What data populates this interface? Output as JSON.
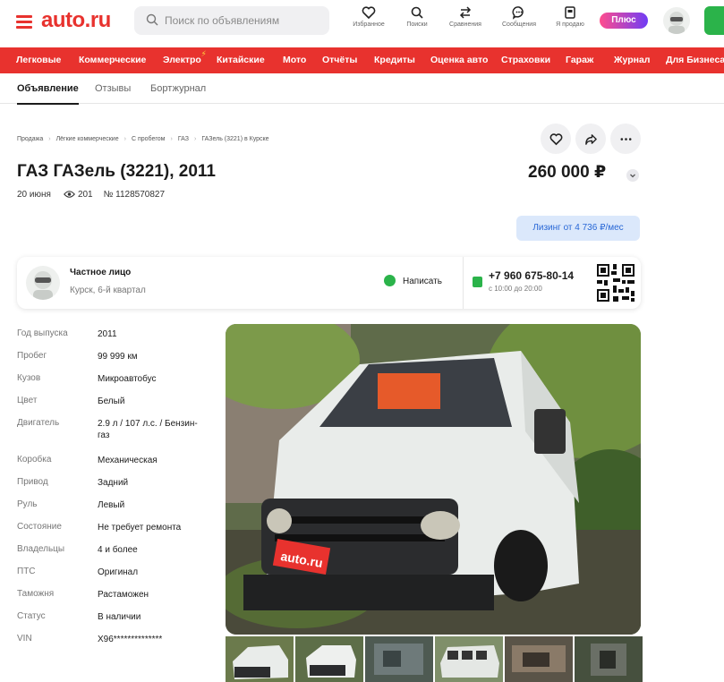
{
  "header": {
    "logo": "auto.ru",
    "search_placeholder": "Поиск по объявлениям",
    "items": [
      {
        "label": "Избранное",
        "icon": "heart-icon"
      },
      {
        "label": "Поиски",
        "icon": "saved-search-icon"
      },
      {
        "label": "Сравнения",
        "icon": "compare-icon"
      },
      {
        "label": "Сообщения",
        "icon": "messages-icon"
      },
      {
        "label": "Я продаю",
        "icon": "my-ads-icon"
      }
    ],
    "plus_label": "Плюс"
  },
  "nav": [
    "Легковые",
    "Коммерческие",
    "Электро",
    "Китайские",
    "Мото",
    "Отчёты",
    "Кредиты",
    "Оценка авто",
    "Страховки",
    "Гараж",
    "Журнал",
    "Для Бизнеса"
  ],
  "tabs": [
    {
      "label": "Объявление",
      "active": true
    },
    {
      "label": "Отзывы",
      "active": false
    },
    {
      "label": "Бортжурнал",
      "active": false
    }
  ],
  "breadcrumbs": [
    "Продажа",
    "Лёгкие коммерческие",
    "С пробегом",
    "ГАЗ",
    "ГАЗель (3221) в Курске"
  ],
  "listing": {
    "title": "ГАЗ ГАЗель (3221), 2011",
    "price": "260 000 ₽",
    "date": "20 июня",
    "views": "201",
    "number": "№ 1128570827",
    "leasing": "Лизинг от 4 736 ₽/мес"
  },
  "seller": {
    "type": "Частное лицо",
    "location": "Курск, 6-й квартал",
    "write_label": "Написать",
    "phone": "+7 960 675-80-14",
    "hours": "с 10:00 до 20:00"
  },
  "specs": [
    {
      "k": "Год выпуска",
      "v": "2011"
    },
    {
      "k": "Пробег",
      "v": "99 999 км"
    },
    {
      "k": "Кузов",
      "v": "Микроавтобус"
    },
    {
      "k": "Цвет",
      "v": "Белый"
    },
    {
      "k": "Двигатель",
      "v": "2.9 л / 107 л.с. / Бензин-газ"
    },
    {
      "k": "Коробка",
      "v": "Механическая"
    },
    {
      "k": "Привод",
      "v": "Задний"
    },
    {
      "k": "Руль",
      "v": "Левый"
    },
    {
      "k": "Состояние",
      "v": "Не требует ремонта"
    },
    {
      "k": "Владельцы",
      "v": "4 и более"
    },
    {
      "k": "ПТС",
      "v": "Оригинал"
    },
    {
      "k": "Таможня",
      "v": "Растаможен"
    },
    {
      "k": "Статус",
      "v": "В наличии"
    },
    {
      "k": "VIN",
      "v": "X96**************"
    }
  ],
  "photo": {
    "plate_text": "auto.ru",
    "thumb_count": 6
  },
  "colors": {
    "brand": "#e8322e",
    "green": "#2bb34a",
    "link_blue": "#2867d6"
  }
}
